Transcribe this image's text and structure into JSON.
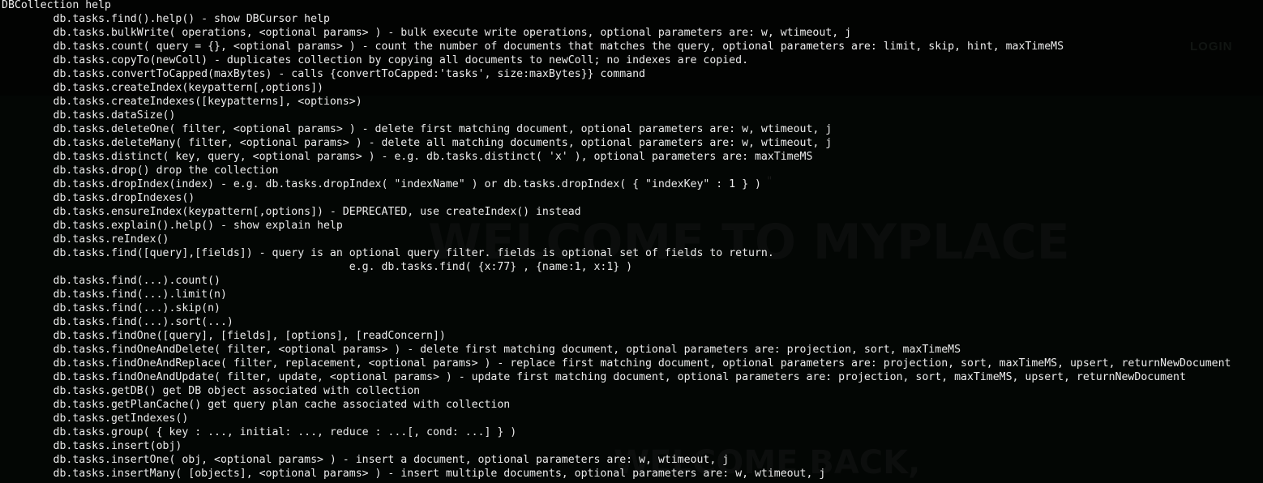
{
  "background_site": {
    "login_label": "LOGIN",
    "hero_title": "WELCOME TO MYPLACE",
    "sub_title": "WELCOME BACK,",
    "stray_mark": "\""
  },
  "terminal": {
    "header": "DBCollection help",
    "lines": [
      "db.tasks.find().help() - show DBCursor help",
      "db.tasks.bulkWrite( operations, <optional params> ) - bulk execute write operations, optional parameters are: w, wtimeout, j",
      "db.tasks.count( query = {}, <optional params> ) - count the number of documents that matches the query, optional parameters are: limit, skip, hint, maxTimeMS",
      "db.tasks.copyTo(newColl) - duplicates collection by copying all documents to newColl; no indexes are copied.",
      "db.tasks.convertToCapped(maxBytes) - calls {convertToCapped:'tasks', size:maxBytes}} command",
      "db.tasks.createIndex(keypattern[,options])",
      "db.tasks.createIndexes([keypatterns], <options>)",
      "db.tasks.dataSize()",
      "db.tasks.deleteOne( filter, <optional params> ) - delete first matching document, optional parameters are: w, wtimeout, j",
      "db.tasks.deleteMany( filter, <optional params> ) - delete all matching documents, optional parameters are: w, wtimeout, j",
      "db.tasks.distinct( key, query, <optional params> ) - e.g. db.tasks.distinct( 'x' ), optional parameters are: maxTimeMS",
      "db.tasks.drop() drop the collection",
      "db.tasks.dropIndex(index) - e.g. db.tasks.dropIndex( \"indexName\" ) or db.tasks.dropIndex( { \"indexKey\" : 1 } )",
      "db.tasks.dropIndexes()",
      "db.tasks.ensureIndex(keypattern[,options]) - DEPRECATED, use createIndex() instead",
      "db.tasks.explain().help() - show explain help",
      "db.tasks.reIndex()",
      "db.tasks.find([query],[fields]) - query is an optional query filter. fields is optional set of fields to return.",
      "                                              e.g. db.tasks.find( {x:77} , {name:1, x:1} )",
      "db.tasks.find(...).count()",
      "db.tasks.find(...).limit(n)",
      "db.tasks.find(...).skip(n)",
      "db.tasks.find(...).sort(...)",
      "db.tasks.findOne([query], [fields], [options], [readConcern])",
      "db.tasks.findOneAndDelete( filter, <optional params> ) - delete first matching document, optional parameters are: projection, sort, maxTimeMS",
      "db.tasks.findOneAndReplace( filter, replacement, <optional params> ) - replace first matching document, optional parameters are: projection, sort, maxTimeMS, upsert, returnNewDocument",
      "db.tasks.findOneAndUpdate( filter, update, <optional params> ) - update first matching document, optional parameters are: projection, sort, maxTimeMS, upsert, returnNewDocument",
      "db.tasks.getDB() get DB object associated with collection",
      "db.tasks.getPlanCache() get query plan cache associated with collection",
      "db.tasks.getIndexes()",
      "db.tasks.group( { key : ..., initial: ..., reduce : ...[, cond: ...] } )",
      "db.tasks.insert(obj)",
      "db.tasks.insertOne( obj, <optional params> ) - insert a document, optional parameters are: w, wtimeout, j",
      "db.tasks.insertMany( [objects], <optional params> ) - insert multiple documents, optional parameters are: w, wtimeout, j"
    ]
  }
}
